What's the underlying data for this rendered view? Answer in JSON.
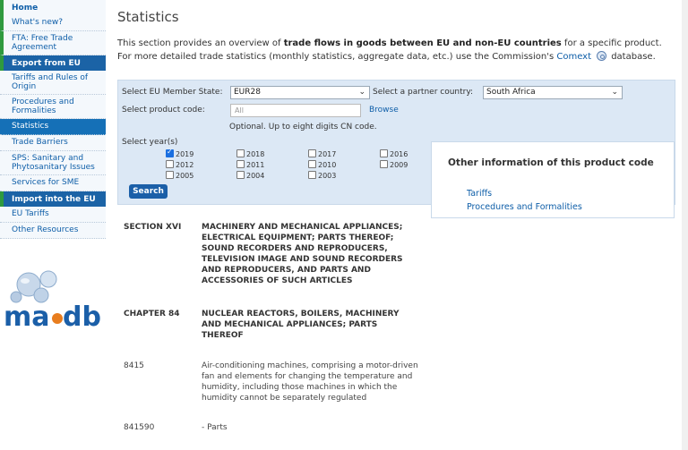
{
  "sidebar": {
    "items": [
      {
        "label": "Home",
        "kind": "first"
      },
      {
        "label": "What's new?",
        "kind": "item"
      },
      {
        "label": "FTA: Free Trade Agreement",
        "kind": "item"
      },
      {
        "label": "Export from EU",
        "kind": "head"
      },
      {
        "label": "Tariffs and Rules of Origin",
        "kind": "item"
      },
      {
        "label": "Procedures and Formalities",
        "kind": "item"
      },
      {
        "label": "Statistics",
        "kind": "active"
      },
      {
        "label": "Trade Barriers",
        "kind": "item"
      },
      {
        "label": "SPS: Sanitary and Phytosanitary Issues",
        "kind": "item"
      },
      {
        "label": "Services for SME",
        "kind": "item"
      },
      {
        "label": "Import into the EU",
        "kind": "head"
      },
      {
        "label": "EU Tariffs",
        "kind": "item"
      },
      {
        "label": "Other Resources",
        "kind": "item"
      }
    ],
    "logo_text": "madb"
  },
  "page": {
    "title": "Statistics",
    "intro_1": "This section provides an overview of ",
    "intro_bold": "trade flows in goods between EU and non-EU countries",
    "intro_2": " for a specific product. For more detailed trade statistics (monthly statistics, aggregate data, etc.) use the Commission's ",
    "intro_link": "Comext",
    "intro_3": " database."
  },
  "form": {
    "member_label": "Select EU Member State:",
    "member_value": "EUR28",
    "partner_label": "Select a partner country:",
    "partner_value": "South Africa",
    "product_label": "Select product code:",
    "product_placeholder": "All",
    "browse": "Browse",
    "optional_note": "Optional. Up to eight digits CN code.",
    "year_label": "Select year(s)",
    "years": [
      "2019",
      "2018",
      "2017",
      "2016",
      "2012",
      "2011",
      "2010",
      "2009",
      "2005",
      "2004",
      "2003"
    ],
    "checked_year": "2019",
    "search_button": "Search"
  },
  "info": {
    "title": "Other information of this product code",
    "links": [
      "Tariffs",
      "Procedures and Formalities"
    ]
  },
  "classification": {
    "section_code": "SECTION XVI",
    "section_desc": "MACHINERY AND MECHANICAL APPLIANCES; ELECTRICAL EQUIPMENT; PARTS THEREOF; SOUND RECORDERS AND REPRODUCERS, TELEVISION IMAGE AND SOUND RECORDERS AND REPRODUCERS, AND PARTS AND ACCESSORIES OF SUCH ARTICLES",
    "chapter_code": "CHAPTER 84",
    "chapter_desc": "NUCLEAR REACTORS, BOILERS, MACHINERY AND MECHANICAL APPLIANCES; PARTS THEREOF",
    "heading_code": "8415",
    "heading_desc": "Air-conditioning machines, comprising a motor-driven fan and elements for changing the temperature and humidity, including those machines in which the humidity cannot be separately regulated",
    "sub_code": "841590",
    "sub_desc": "- Parts"
  }
}
